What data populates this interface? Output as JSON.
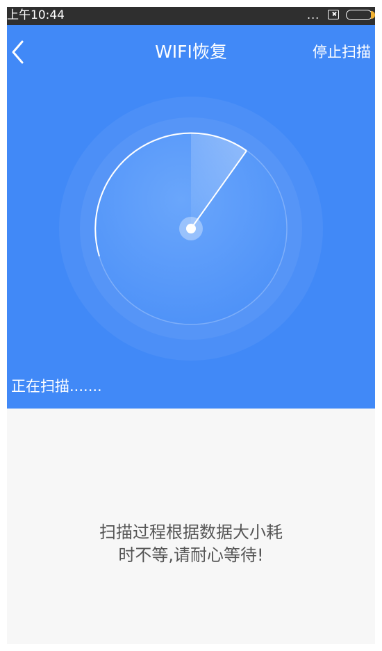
{
  "status_bar": {
    "time": "上午10:44",
    "dots": "...",
    "icons": [
      "sim-x-icon",
      "battery-icon"
    ]
  },
  "header": {
    "back_icon": "chevron-left-icon",
    "title": "WIFI恢复",
    "stop_label": "停止扫描"
  },
  "scanner": {
    "status_text": "正在扫描.......",
    "accent_color": "#4189f7"
  },
  "message": {
    "line1": "扫描过程根据数据大小耗",
    "line2": "时不等,请耐心等待!"
  }
}
